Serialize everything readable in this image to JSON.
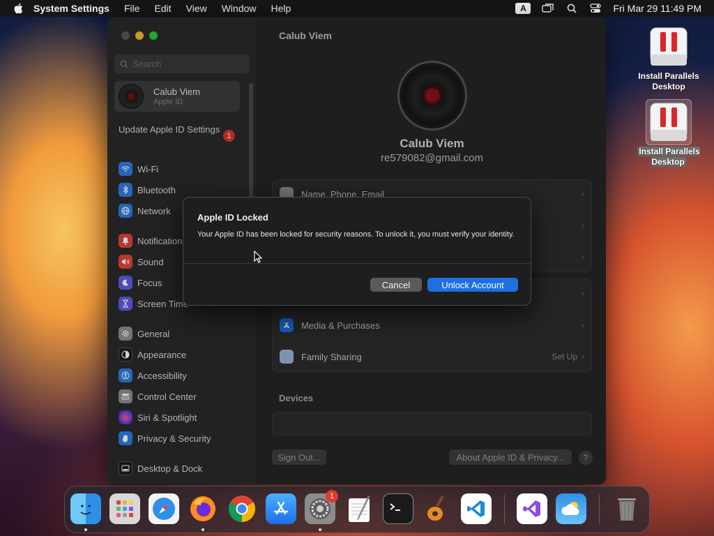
{
  "menubar": {
    "app_name": "System Settings",
    "menus": [
      "File",
      "Edit",
      "View",
      "Window",
      "Help"
    ],
    "input_source": "A",
    "datetime": "Fri Mar 29  11:49 PM"
  },
  "sidebar": {
    "search_placeholder": "Search",
    "user": {
      "name": "Calub Viem",
      "subtitle": "Apple ID"
    },
    "update": {
      "label": "Update Apple ID Settings",
      "badge": "1"
    },
    "items": [
      {
        "label": "Wi-Fi",
        "icon": "wifi-icon",
        "color": "#2f7de1"
      },
      {
        "label": "Bluetooth",
        "icon": "bluetooth-icon",
        "color": "#2f7de1"
      },
      {
        "label": "Network",
        "icon": "globe-icon",
        "color": "#2f7de1"
      },
      {
        "label": "Notifications",
        "icon": "bell-icon",
        "color": "#e0453a"
      },
      {
        "label": "Sound",
        "icon": "speaker-icon",
        "color": "#e0453a"
      },
      {
        "label": "Focus",
        "icon": "moon-icon",
        "color": "#5e5ce6"
      },
      {
        "label": "Screen Time",
        "icon": "hourglass-icon",
        "color": "#5e5ce6"
      },
      {
        "label": "General",
        "icon": "gear-icon",
        "color": "#8e8e93"
      },
      {
        "label": "Appearance",
        "icon": "appearance-icon",
        "color": "#1c1c1e"
      },
      {
        "label": "Accessibility",
        "icon": "accessibility-icon",
        "color": "#2f7de1"
      },
      {
        "label": "Control Center",
        "icon": "control-center-icon",
        "color": "#8e8e93"
      },
      {
        "label": "Siri & Spotlight",
        "icon": "siri-icon",
        "color": "#b04be0"
      },
      {
        "label": "Privacy & Security",
        "icon": "hand-icon",
        "color": "#2f7de1"
      },
      {
        "label": "Desktop & Dock",
        "icon": "dock-icon",
        "color": "#1c1c1e"
      }
    ]
  },
  "main": {
    "title": "Calub Viem",
    "profile_name": "Calub Viem",
    "email": "re579082@gmail.com",
    "rows": {
      "name_phone_email": "Name, Phone, Email",
      "media_purchases": "Media & Purchases",
      "family_sharing": "Family Sharing",
      "family_sharing_action": "Set Up"
    },
    "devices_heading": "Devices",
    "sign_out": "Sign Out...",
    "about": "About Apple ID & Privacy...",
    "help": "?"
  },
  "dialog": {
    "title": "Apple ID Locked",
    "message": "Your Apple ID has been locked for security reasons. To unlock it, you must verify your identity.",
    "cancel": "Cancel",
    "confirm": "Unlock Account"
  },
  "desktop": {
    "icon1": "Install Parallels Desktop",
    "icon2": "Install Parallels Desktop"
  },
  "dock": {
    "apps": [
      "Finder",
      "Launchpad",
      "Safari",
      "Firefox",
      "Chrome",
      "App Store",
      "System Settings",
      "TextEdit",
      "Terminal",
      "GarageBand",
      "Visual Studio Code",
      "Visual Studio",
      "Weather",
      "Trash"
    ],
    "settings_badge": "1"
  }
}
